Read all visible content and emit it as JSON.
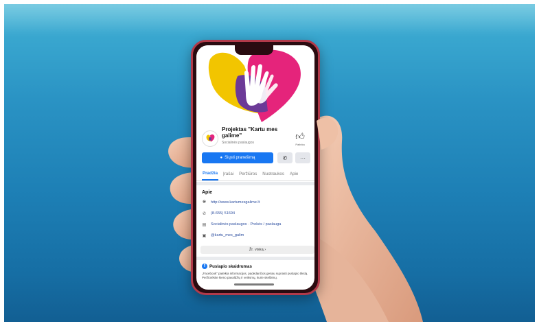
{
  "page": {
    "name": "Projektas \"Kartu mes galime\"",
    "category": "Socialinės paslaugos"
  },
  "like": {
    "label": "Patinka"
  },
  "actions": {
    "message_label": "Siųsti pranešimą",
    "phone_icon": "phone-icon",
    "more_icon": "more-icon"
  },
  "tabs": [
    {
      "label": "Pradžia",
      "active": true
    },
    {
      "label": "Įrašai",
      "active": false
    },
    {
      "label": "Peržiūros",
      "active": false
    },
    {
      "label": "Nuotraukos",
      "active": false
    },
    {
      "label": "Apie",
      "active": false
    }
  ],
  "about": {
    "title": "Apie",
    "website": "http://www.kartumesgalime.lt",
    "phone": "(8-655) 51694",
    "category_link": "Socialinės paslaugos · Prekės / paslauga",
    "instagram": "@kartu_mes_galim",
    "more_label": "Žr. viską  ›"
  },
  "transparency": {
    "title": "Puslapio skaidrumas",
    "text": "„Facebook“ pateikia informacijos, padedančios geriau suprasti puslapio tikslą. Peržiūrėkite kieno pavaldžių ir veiksmų, kurie skelbimų."
  },
  "colors": {
    "background_top": "#5cc0dc",
    "background_bottom": "#125f93",
    "facebook_blue": "#1877f2",
    "phone_frame": "#b23a4a",
    "logo_yellow": "#f2c500",
    "logo_pink": "#e5247b",
    "logo_purple": "#6c3a97"
  }
}
